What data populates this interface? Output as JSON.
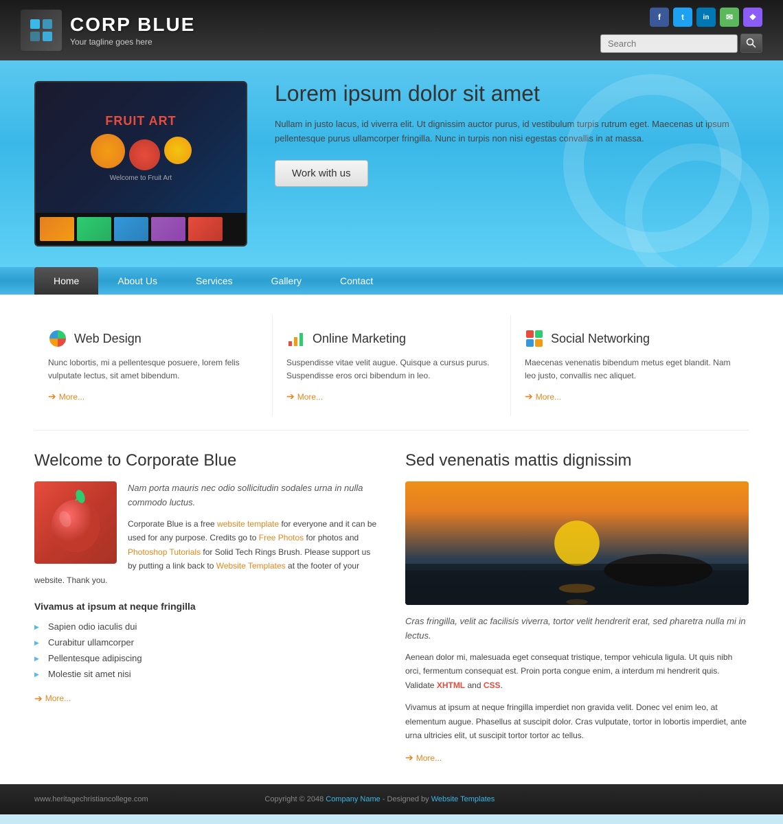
{
  "header": {
    "logo_title": "CORP BLUE",
    "logo_tagline": "Your tagline goes here",
    "search_placeholder": "Search",
    "social": [
      {
        "name": "facebook",
        "label": "f",
        "class": "si-fb"
      },
      {
        "name": "twitter",
        "label": "t",
        "class": "si-tw"
      },
      {
        "name": "linkedin",
        "label": "in",
        "class": "si-li"
      },
      {
        "name": "message",
        "label": "✉",
        "class": "si-msg"
      },
      {
        "name": "rss",
        "label": "❖",
        "class": "si-rss"
      }
    ]
  },
  "hero": {
    "title": "Lorem ipsum dolor sit amet",
    "description": "Nullam in justo lacus, id viverra elit. Ut dignissim auctor purus, id vestibulum turpis rutrum eget. Maecenas ut ipsum pellentesque purus ullamcorper fringilla. Nunc in turpis non nisi egestas convallis in at massa.",
    "cta_label": "Work with us",
    "fruit_art_label": "FRUIT ART"
  },
  "nav": {
    "items": [
      {
        "label": "Home",
        "active": true
      },
      {
        "label": "About Us",
        "active": false
      },
      {
        "label": "Services",
        "active": false
      },
      {
        "label": "Gallery",
        "active": false
      },
      {
        "label": "Contact",
        "active": false
      }
    ]
  },
  "features": [
    {
      "title": "Web Design",
      "description": "Nunc lobortis, mi a pellentesque posuere, lorem felis vulputate lectus, sit amet bibendum.",
      "more_label": "More..."
    },
    {
      "title": "Online Marketing",
      "description": "Suspendisse vitae velit augue. Quisque a cursus purus. Suspendisse eros orci bibendum in leo.",
      "more_label": "More..."
    },
    {
      "title": "Social Networking",
      "description": "Maecenas venenatis bibendum metus eget blandit. Nam leo justo, convallis nec aliquet.",
      "more_label": "More..."
    }
  ],
  "left_section": {
    "title": "Welcome to Corporate Blue",
    "italic_intro": "Nam porta mauris nec odio sollicitudin sodales urna in nulla commodo luctus.",
    "body_p1_pre": "Corporate Blue is a free ",
    "body_p1_link1": "website template",
    "body_p1_mid": " for everyone and it can be used for any purpose. Credits go to ",
    "body_p1_link2": "Free Photos",
    "body_p1_mid2": " for photos and ",
    "body_p1_link3": "Photoshop Tutorials",
    "body_p1_end": " for Solid Tech Rings Brush. Please support us by putting a link back to ",
    "body_p1_link4": "Website Templates",
    "body_p1_final": " at the footer of your website. Thank you.",
    "sub_title": "Vivamus at ipsum at neque fringilla",
    "bullet_items": [
      "Sapien odio iaculis dui",
      "Curabitur ullamcorper",
      "Pellentesque adipiscing",
      "Molestie sit amet nisi"
    ],
    "more_label": "More..."
  },
  "right_section": {
    "title": "Sed venenatis mattis dignissim",
    "italic_caption": "Cras fringilla, velit ac facilisis viverra, tortor velit hendrerit erat, sed pharetra nulla mi in lectus.",
    "body_p1": "Aenean dolor mi, malesuada eget consequat tristique, tempor vehicula ligula. Ut quis nibh orci, fermentum consequat est. Proin porta congue enim, a interdum mi hendrerit quis. Validate ",
    "xhtml_label": "XHTML",
    "body_p1_mid": " and ",
    "css_label": "CSS",
    "body_p1_end": ".",
    "body_p2": "Vivamus at ipsum at neque fringilla imperdiet non gravida velit. Donec vel enim leo, at elementum augue. Phasellus at suscipit dolor. Cras vulputate, tortor in lobortis imperdiet, ante urna ultricies elit, ut suscipit tortor tortor ac tellus.",
    "more_label": "More..."
  },
  "footer": {
    "left_text": "www.heritagechristiancollege.com",
    "copyright_pre": "Copyright © 2048 ",
    "company_name": "Company Name",
    "copyright_mid": " - Designed by ",
    "templates_label": "Website Templates"
  }
}
